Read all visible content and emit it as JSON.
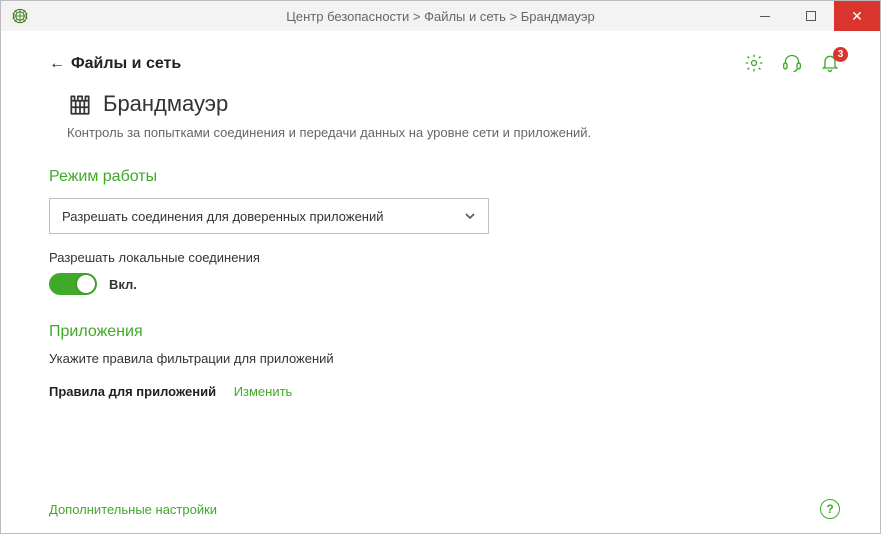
{
  "window": {
    "breadcrumb": "Центр безопасности > Файлы и сеть > Брандмауэр"
  },
  "header": {
    "back_label": "Файлы и сеть",
    "notification_count": "3"
  },
  "page": {
    "title": "Брандмауэр",
    "description": "Контроль за попытками соединения и передачи данных на уровне сети и приложений."
  },
  "mode": {
    "section_title": "Режим работы",
    "selected": "Разрешать соединения для доверенных приложений",
    "local_conn_label": "Разрешать локальные соединения",
    "toggle_state": "Вкл."
  },
  "apps": {
    "section_title": "Приложения",
    "description": "Укажите правила фильтрации для приложений",
    "rules_label": "Правила для приложений",
    "change_link": "Изменить"
  },
  "footer": {
    "more_settings": "Дополнительные настройки"
  },
  "colors": {
    "accent": "#3fa92a",
    "danger": "#d9342d"
  }
}
